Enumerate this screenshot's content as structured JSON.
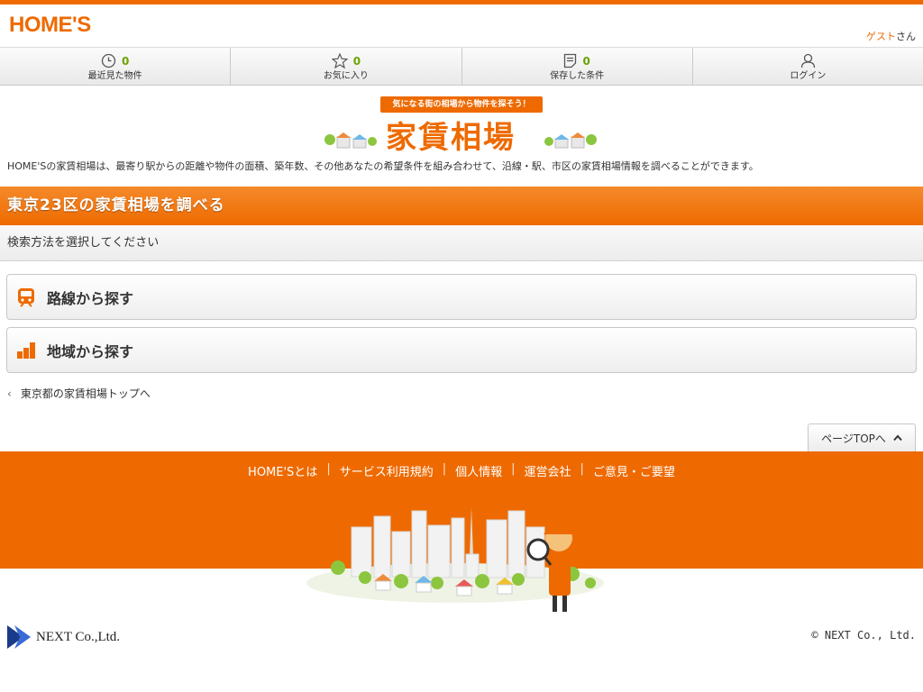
{
  "header": {
    "logo": "HOME'S",
    "guest_name": "ゲスト",
    "guest_suffix": "さん"
  },
  "nav": {
    "recent": {
      "count": "0",
      "label": "最近見た物件"
    },
    "favorites": {
      "count": "0",
      "label": "お気に入り"
    },
    "saved": {
      "count": "0",
      "label": "保存した条件"
    },
    "login": {
      "label": "ログイン"
    }
  },
  "banner": {
    "ribbon": "気になる街の相場から物件を探そう！",
    "title": "家賃相場"
  },
  "intro": "HOME'Sの家賃相場は、最寄り駅からの距離や物件の面積、築年数、その他あなたの希望条件を組み合わせて、沿線・駅、市区の家賃相場情報を調べることができます。",
  "section": {
    "title": "東京23区の家賃相場を調べる",
    "subtitle": "検索方法を選択してください"
  },
  "options": {
    "line": "路線から探す",
    "area": "地域から探す"
  },
  "back_link": "東京都の家賃相場トップへ",
  "page_top": "ページTOPへ",
  "footer": {
    "links": [
      "HOME'Sとは",
      "サービス利用規約",
      "個人情報",
      "運営会社",
      "ご意見・ご要望"
    ],
    "company": "NEXT Co.,Ltd.",
    "copyright": "© NEXT Co., Ltd."
  },
  "colors": {
    "brand": "#ee6a00",
    "count": "#6aa300"
  }
}
